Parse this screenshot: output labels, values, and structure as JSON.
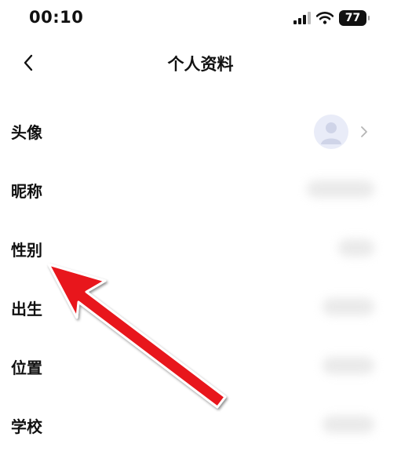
{
  "status_bar": {
    "time": "00:10",
    "battery": "77",
    "icons": [
      "cellular-signal-icon",
      "wifi-icon",
      "battery-icon"
    ]
  },
  "nav": {
    "title": "个人资料",
    "back_icon": "chevron-left-icon"
  },
  "rows": [
    {
      "label": "头像"
    },
    {
      "label": "昵称"
    },
    {
      "label": "性别"
    },
    {
      "label": "出生"
    },
    {
      "label": "位置"
    },
    {
      "label": "学校"
    }
  ],
  "colors": {
    "background": "#ffffff",
    "text": "#111111",
    "annotation_arrow": "#e8141b",
    "avatar_bg": "#e9ecf8"
  }
}
